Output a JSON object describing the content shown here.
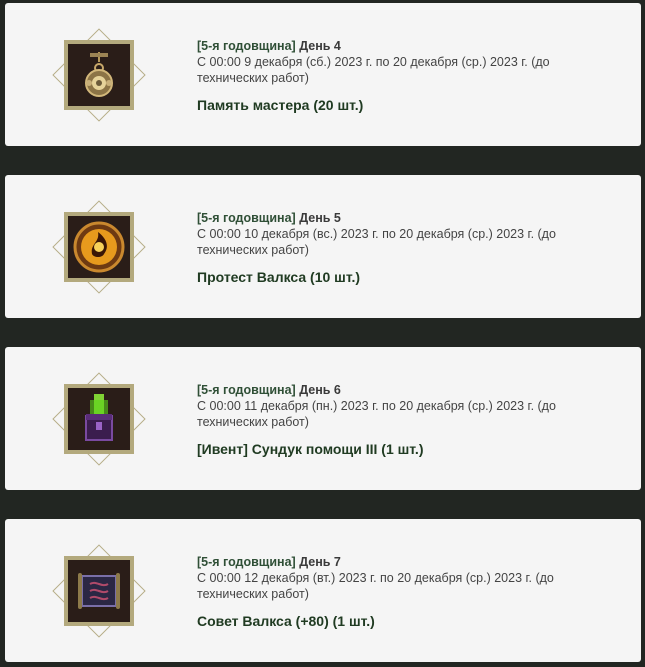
{
  "cards": [
    {
      "tag": "[5-я годовщина]",
      "day": "День 4",
      "date_text": "С 00:00 9 декабря (сб.) 2023 г. по 20 декабря (ср.) 2023 г. (до технических работ)",
      "reward": "Память мастера (20 шт.)",
      "icon": "amulet-icon"
    },
    {
      "tag": "[5-я годовщина]",
      "day": "День 5",
      "date_text": "С 00:00 10 декабря (вс.) 2023 г. по 20 декабря (ср.) 2023 г. (до технических работ)",
      "reward": "Протест Валкса (10 шт.)",
      "icon": "fire-orb-icon"
    },
    {
      "tag": "[5-я годовщина]",
      "day": "День 6",
      "date_text": "С 00:00 11 декабря (пн.) 2023 г. по 20 декабря (ср.) 2023 г. (до технических работ)",
      "reward": "[Ивент] Сундук помощи III (1 шт.)",
      "icon": "chest-icon"
    },
    {
      "tag": "[5-я годовщина]",
      "day": "День 7",
      "date_text": "С 00:00 12 декабря (вт.) 2023 г. по 20 декабря (ср.) 2023 г. (до технических работ)",
      "reward": "Совет Валкса (+80) (1 шт.)",
      "icon": "scroll-icon"
    }
  ]
}
